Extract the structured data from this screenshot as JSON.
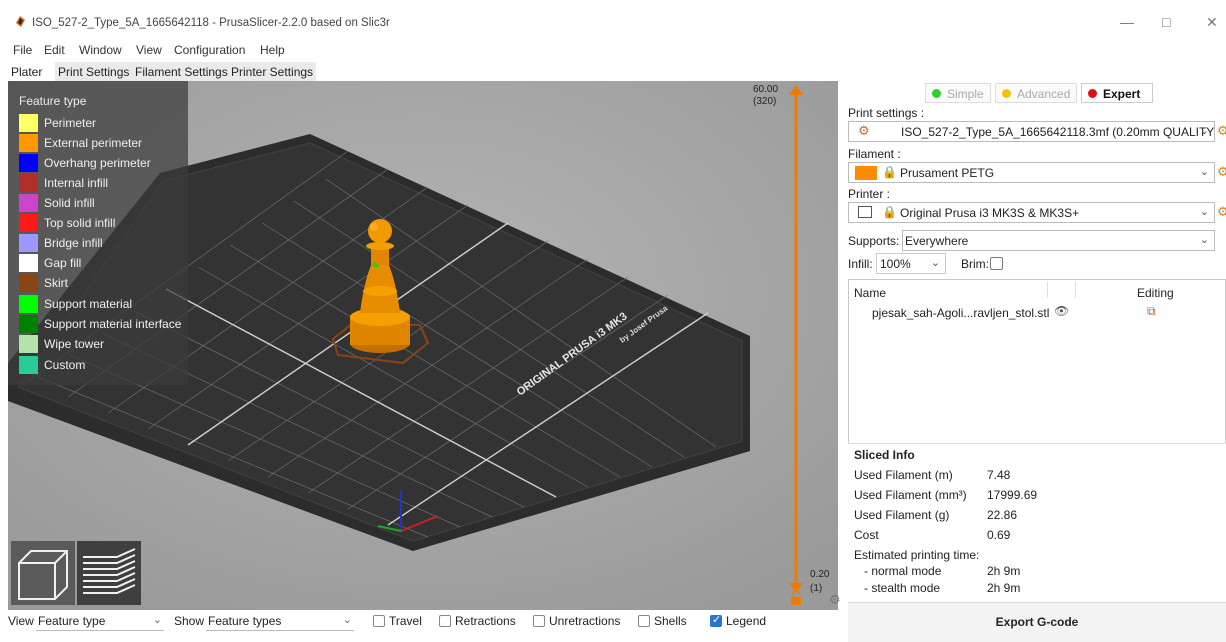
{
  "window": {
    "title": "ISO_527-2_Type_5A_1665642118 - PrusaSlicer-2.2.0 based on Slic3r",
    "minimize": "—",
    "maximize": "□",
    "close": "✕"
  },
  "menu": [
    "File",
    "Edit",
    "Window",
    "View",
    "Configuration",
    "Help"
  ],
  "tabs": [
    "Plater",
    "Print Settings",
    "Filament Settings",
    "Printer Settings"
  ],
  "legend": {
    "title": "Feature type",
    "items": [
      {
        "label": "Perimeter",
        "color": "#ffff66"
      },
      {
        "label": "External perimeter",
        "color": "#ff9900"
      },
      {
        "label": "Overhang perimeter",
        "color": "#0000ff"
      },
      {
        "label": "Internal infill",
        "color": "#b03029"
      },
      {
        "label": "Solid infill",
        "color": "#cc44cc"
      },
      {
        "label": "Top solid infill",
        "color": "#ff1a1a"
      },
      {
        "label": "Bridge infill",
        "color": "#9999ff"
      },
      {
        "label": "Gap fill",
        "color": "#ffffff"
      },
      {
        "label": "Skirt",
        "color": "#8b4513"
      },
      {
        "label": "Support material",
        "color": "#00ff00"
      },
      {
        "label": "Support material interface",
        "color": "#008000"
      },
      {
        "label": "Wipe tower",
        "color": "#b3e3ab"
      },
      {
        "label": "Custom",
        "color": "#28cc94"
      }
    ]
  },
  "bed": {
    "brand": "ORIGINAL PRUSA i3 MK3",
    "byline": "by Josef Prusa"
  },
  "slider": {
    "top_value": "60.00",
    "top_layer": "(320)",
    "bottom_value": "0.20",
    "bottom_layer": "(1)"
  },
  "modes": [
    {
      "label": "Simple",
      "color": "#33cc33",
      "active": false
    },
    {
      "label": "Advanced",
      "color": "#f2c200",
      "active": false
    },
    {
      "label": "Expert",
      "color": "#e01010",
      "active": true
    }
  ],
  "print_settings": {
    "label": "Print settings :",
    "value": "ISO_527-2_Type_5A_1665642118.3mf (0.20mm QUALITY"
  },
  "filament": {
    "label": "Filament :",
    "value": "Prusament PETG",
    "color": "#ff8c00"
  },
  "printer": {
    "label": "Printer :",
    "value": "Original Prusa i3 MK3S & MK3S+"
  },
  "supports": {
    "label": "Supports:",
    "value": "Everywhere"
  },
  "infill": {
    "label": "Infill:",
    "value": "100%"
  },
  "brim": {
    "label": "Brim:"
  },
  "object_list": {
    "col_name": "Name",
    "col_editing": "Editing",
    "objects": [
      {
        "name": "pjesak_sah-Agoli...ravljen_stol.stl"
      }
    ]
  },
  "sliced_info": {
    "title": "Sliced Info",
    "rows": [
      {
        "label": "Used Filament (m)",
        "value": "7.48"
      },
      {
        "label": "Used Filament (mm³)",
        "value": "17999.69"
      },
      {
        "label": "Used Filament (g)",
        "value": "22.86"
      },
      {
        "label": "Cost",
        "value": "0.69"
      }
    ],
    "time_label": "Estimated printing time:",
    "normal_label": "- normal mode",
    "normal_value": "2h 9m",
    "stealth_label": "- stealth mode",
    "stealth_value": "2h 9m"
  },
  "export_label": "Export G-code",
  "bottom": {
    "view_label": "View",
    "view_value": "Feature type",
    "show_label": "Show",
    "show_value": "Feature types",
    "checks": [
      {
        "label": "Travel",
        "checked": false
      },
      {
        "label": "Retractions",
        "checked": false
      },
      {
        "label": "Unretractions",
        "checked": false
      },
      {
        "label": "Shells",
        "checked": false
      },
      {
        "label": "Legend",
        "checked": true
      }
    ]
  }
}
